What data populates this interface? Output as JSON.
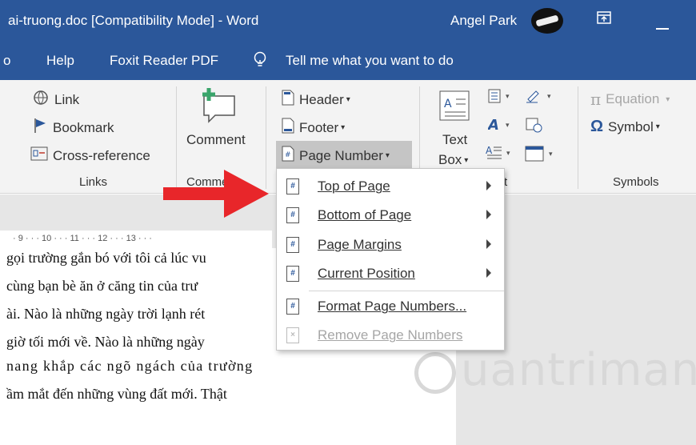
{
  "titlebar": {
    "title": "ai-truong.doc [Compatibility Mode]  -  Word",
    "user": "Angel Park",
    "restore_icon": "ribbon-display-icon",
    "minimize_icon": "minimize-icon"
  },
  "tabs": {
    "partial": "o",
    "help": "Help",
    "foxit": "Foxit Reader PDF",
    "tellme": "Tell me what you want to do"
  },
  "ribbon": {
    "links": {
      "link": "Link",
      "bookmark": "Bookmark",
      "crossref": "Cross-reference",
      "label": "Links"
    },
    "comments": {
      "comment": "Comment",
      "label": "Comme"
    },
    "header_footer": {
      "header": "Header",
      "footer": "Footer",
      "page_number": "Page Number"
    },
    "text": {
      "textbox_line1": "Text",
      "textbox_line2": "Box",
      "label": "t"
    },
    "symbols": {
      "equation": "Equation",
      "symbol": "Symbol",
      "label": "Symbols"
    }
  },
  "ruler": "· 9 · · · 10 · · · 11 · · · 12 · · · 13 · · ·",
  "document": {
    "lines": [
      "gọi trường gắn bó với tôi cả lúc vu",
      "cùng bạn bè ăn ở căng tin của trư",
      "ài. Nào là những ngày trời lạnh rét",
      "giờ tối mới về. Nào là những ngày",
      "nang khắp các ngõ ngách của trường",
      "ầm mắt đến những vùng đất mới. Thật"
    ]
  },
  "menu": {
    "items": [
      {
        "label": "Top of Page",
        "icon": "#",
        "submenu": true
      },
      {
        "label": "Bottom of Page",
        "icon": "#",
        "submenu": true
      },
      {
        "label": "Page Margins",
        "icon": "#",
        "submenu": true
      },
      {
        "label": "Current Position",
        "icon": "#",
        "submenu": true
      },
      {
        "label": "Format Page Numbers...",
        "icon": "#",
        "submenu": false
      },
      {
        "label": "Remove Page Numbers",
        "icon": "×",
        "submenu": false,
        "disabled": true
      }
    ]
  },
  "watermark": "uantrimang",
  "colors": {
    "titlebar": "#2b579a",
    "ribbon": "#f3f3f3",
    "arrow": "#e8262a"
  }
}
